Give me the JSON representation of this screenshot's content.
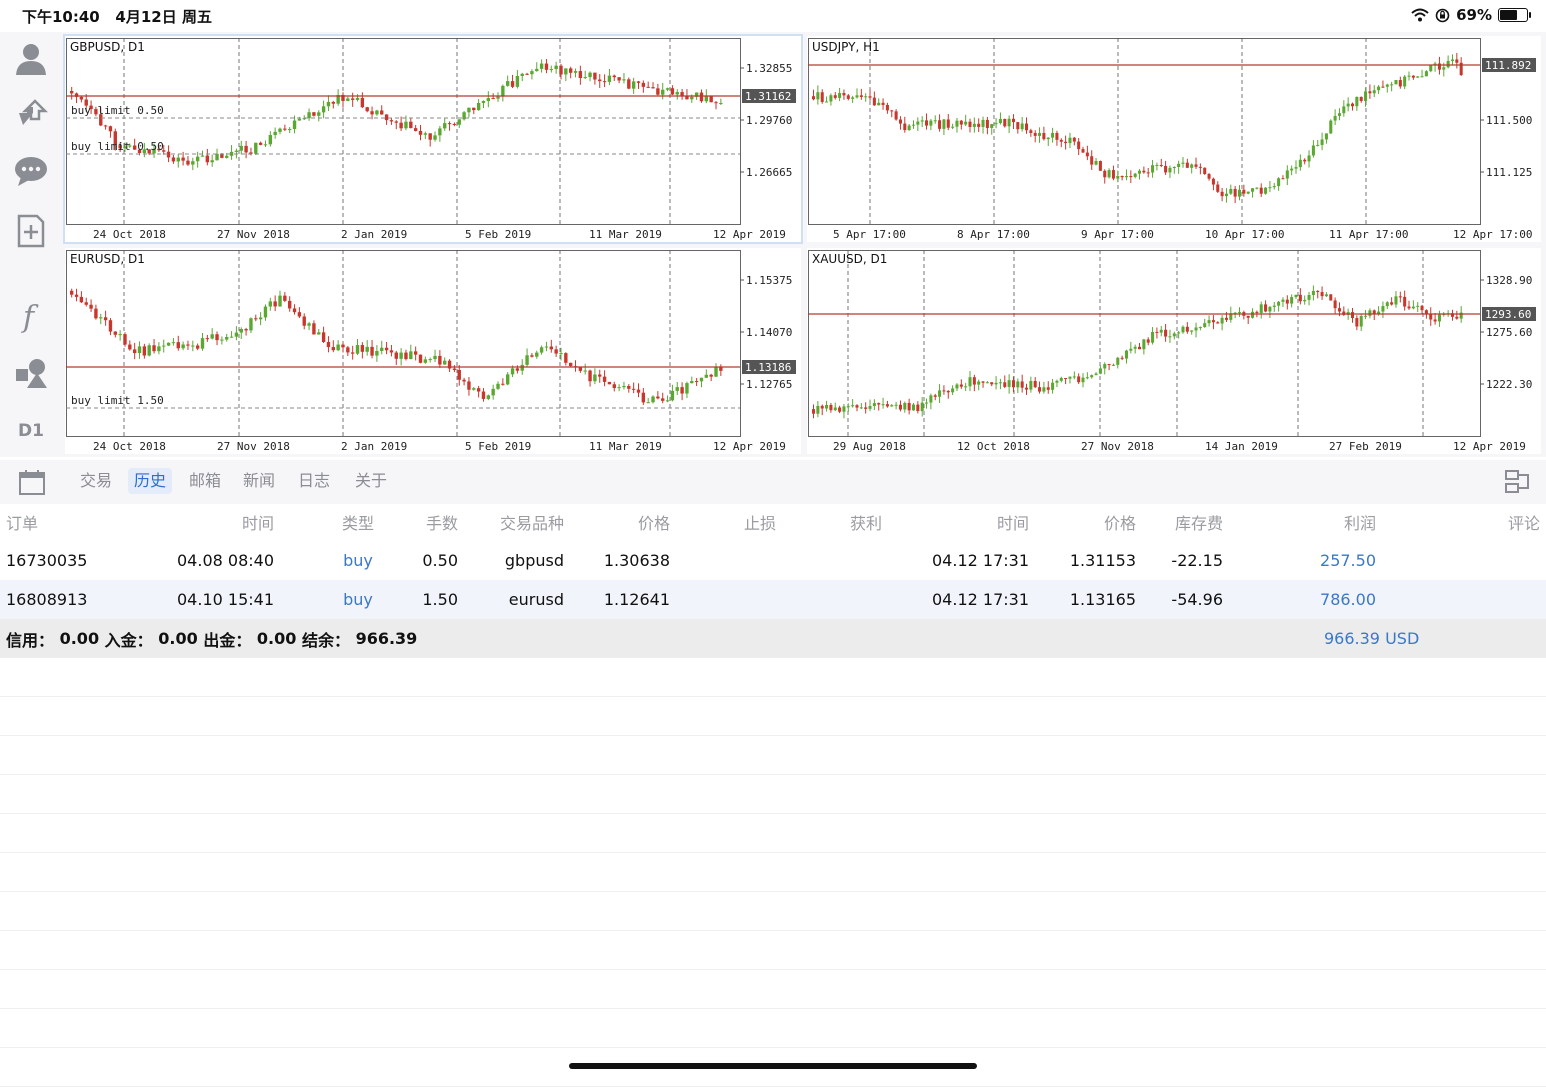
{
  "status_bar": {
    "time": "下午10:40",
    "date": "4月12日 周五",
    "battery": "69%",
    "battery_level": 0.69
  },
  "toolbar": {
    "timeframe": "D1"
  },
  "charts": [
    {
      "title": "GBPUSD, D1",
      "y_ticks": [
        "1.32855",
        "1.29760",
        "1.26665"
      ],
      "price_label": "1.31162",
      "x_labels": [
        "24 Oct 2018",
        "27 Nov 2018",
        "2 Jan 2019",
        "5 Feb 2019",
        "11 Mar 2019",
        "12 Apr 2019"
      ],
      "order_lines": [
        "buy limit 0.50",
        "buy limit 0.50"
      ]
    },
    {
      "title": "USDJPY, H1",
      "y_ticks": [
        "111.500",
        "111.125"
      ],
      "price_label": "111.892",
      "x_labels": [
        "5 Apr 17:00",
        "8 Apr 17:00",
        "9 Apr 17:00",
        "10 Apr 17:00",
        "11 Apr 17:00",
        "12 Apr 17:00"
      ],
      "order_lines": []
    },
    {
      "title": "EURUSD, D1",
      "y_ticks": [
        "1.15375",
        "1.14070",
        "1.12765"
      ],
      "price_label": "1.13186",
      "x_labels": [
        "24 Oct 2018",
        "27 Nov 2018",
        "2 Jan 2019",
        "5 Feb 2019",
        "11 Mar 2019",
        "12 Apr 2019"
      ],
      "order_lines": [
        "buy limit 1.50"
      ]
    },
    {
      "title": "XAUUSD, D1",
      "y_ticks": [
        "1328.90",
        "1275.60",
        "1222.30"
      ],
      "price_label": "1293.60",
      "x_labels": [
        "29 Aug 2018",
        "12 Oct 2018",
        "27 Nov 2018",
        "14 Jan 2019",
        "27 Feb 2019",
        "12 Apr 2019"
      ],
      "order_lines": []
    }
  ],
  "tabs": [
    "交易",
    "历史",
    "邮箱",
    "新闻",
    "日志",
    "关于"
  ],
  "active_tab": "历史",
  "table": {
    "headers": [
      "订单",
      "时间",
      "类型",
      "手数",
      "交易品种",
      "价格",
      "止损",
      "获利",
      "时间",
      "价格",
      "库存费",
      "利润",
      "评论"
    ],
    "rows": [
      {
        "order": "16730035",
        "open_time": "04.08 08:40",
        "type": "buy",
        "lots": "0.50",
        "symbol": "gbpusd",
        "open_price": "1.30638",
        "sl": "",
        "tp": "",
        "close_time": "04.12 17:31",
        "close_price": "1.31153",
        "swap": "-22.15",
        "profit": "257.50",
        "comment": ""
      },
      {
        "order": "16808913",
        "open_time": "04.10 15:41",
        "type": "buy",
        "lots": "1.50",
        "symbol": "eurusd",
        "open_price": "1.12641",
        "sl": "",
        "tp": "",
        "close_time": "04.12 17:31",
        "close_price": "1.13165",
        "swap": "-54.96",
        "profit": "786.00",
        "comment": ""
      }
    ],
    "summary": {
      "credit_label": "信用：",
      "credit": "0.00",
      "deposit_label": "入金：",
      "deposit": "0.00",
      "withdraw_label": "出金：",
      "withdraw": "0.00",
      "balance_label": "结余：",
      "balance": "966.39",
      "total": "966.39",
      "currency": "USD"
    }
  },
  "colors": {
    "bull": "#5aa832",
    "bear": "#c8372d",
    "price_line": "#b23a2e",
    "link": "#3a78c8",
    "active_tab": "#2a6fd0"
  }
}
